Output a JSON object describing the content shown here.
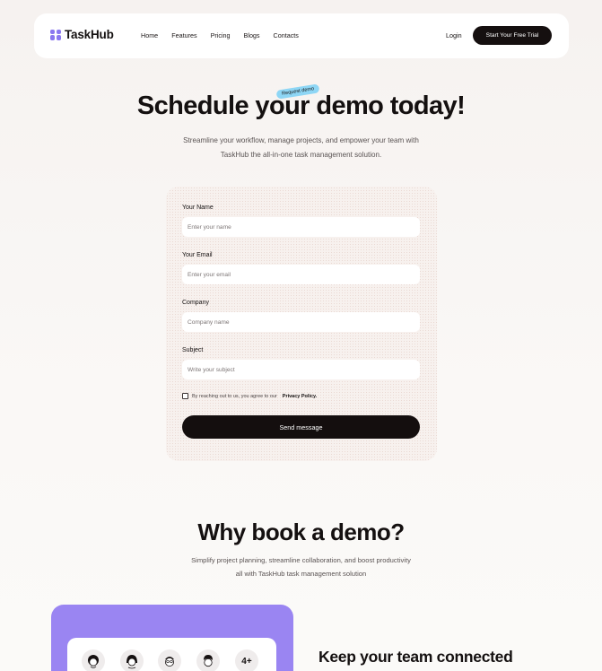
{
  "brand": {
    "name": "TaskHub",
    "logo_icon": "grid-logo-icon",
    "accent": "#8b78f0"
  },
  "nav": {
    "links": [
      "Home",
      "Features",
      "Pricing",
      "Blogs",
      "Contacts"
    ],
    "login": "Login",
    "cta": "Start Your Free Trial"
  },
  "hero": {
    "title": "Schedule your demo today!",
    "tag": "Request demo",
    "subtitle_line1": "Streamline your workflow, manage projects, and empower your team with",
    "subtitle_line2": "TaskHub the all-in-one task management solution."
  },
  "form": {
    "name_label": "Your Name",
    "name_placeholder": "Enter your name",
    "email_label": "Your Email",
    "email_placeholder": "Enter your email",
    "company_label": "Company",
    "company_placeholder": "Company name",
    "subject_label": "Subject",
    "subject_placeholder": "Write your subject",
    "consent_text": "By reaching out to us, you agree to our",
    "consent_link": "Privacy Policy.",
    "submit": "Send message"
  },
  "why": {
    "title": "Why book a demo?",
    "subtitle_line1": "Simplify project planning, streamline collaboration, and boost productivity",
    "subtitle_line2": "all with TaskHub task management solution",
    "panel_color": "#9a85f2",
    "avatars": [
      "avatar-woman-curly",
      "avatar-woman",
      "avatar-man-glasses",
      "avatar-man-curly"
    ],
    "more_count": "4+",
    "feature_title": "Keep your team connected"
  }
}
